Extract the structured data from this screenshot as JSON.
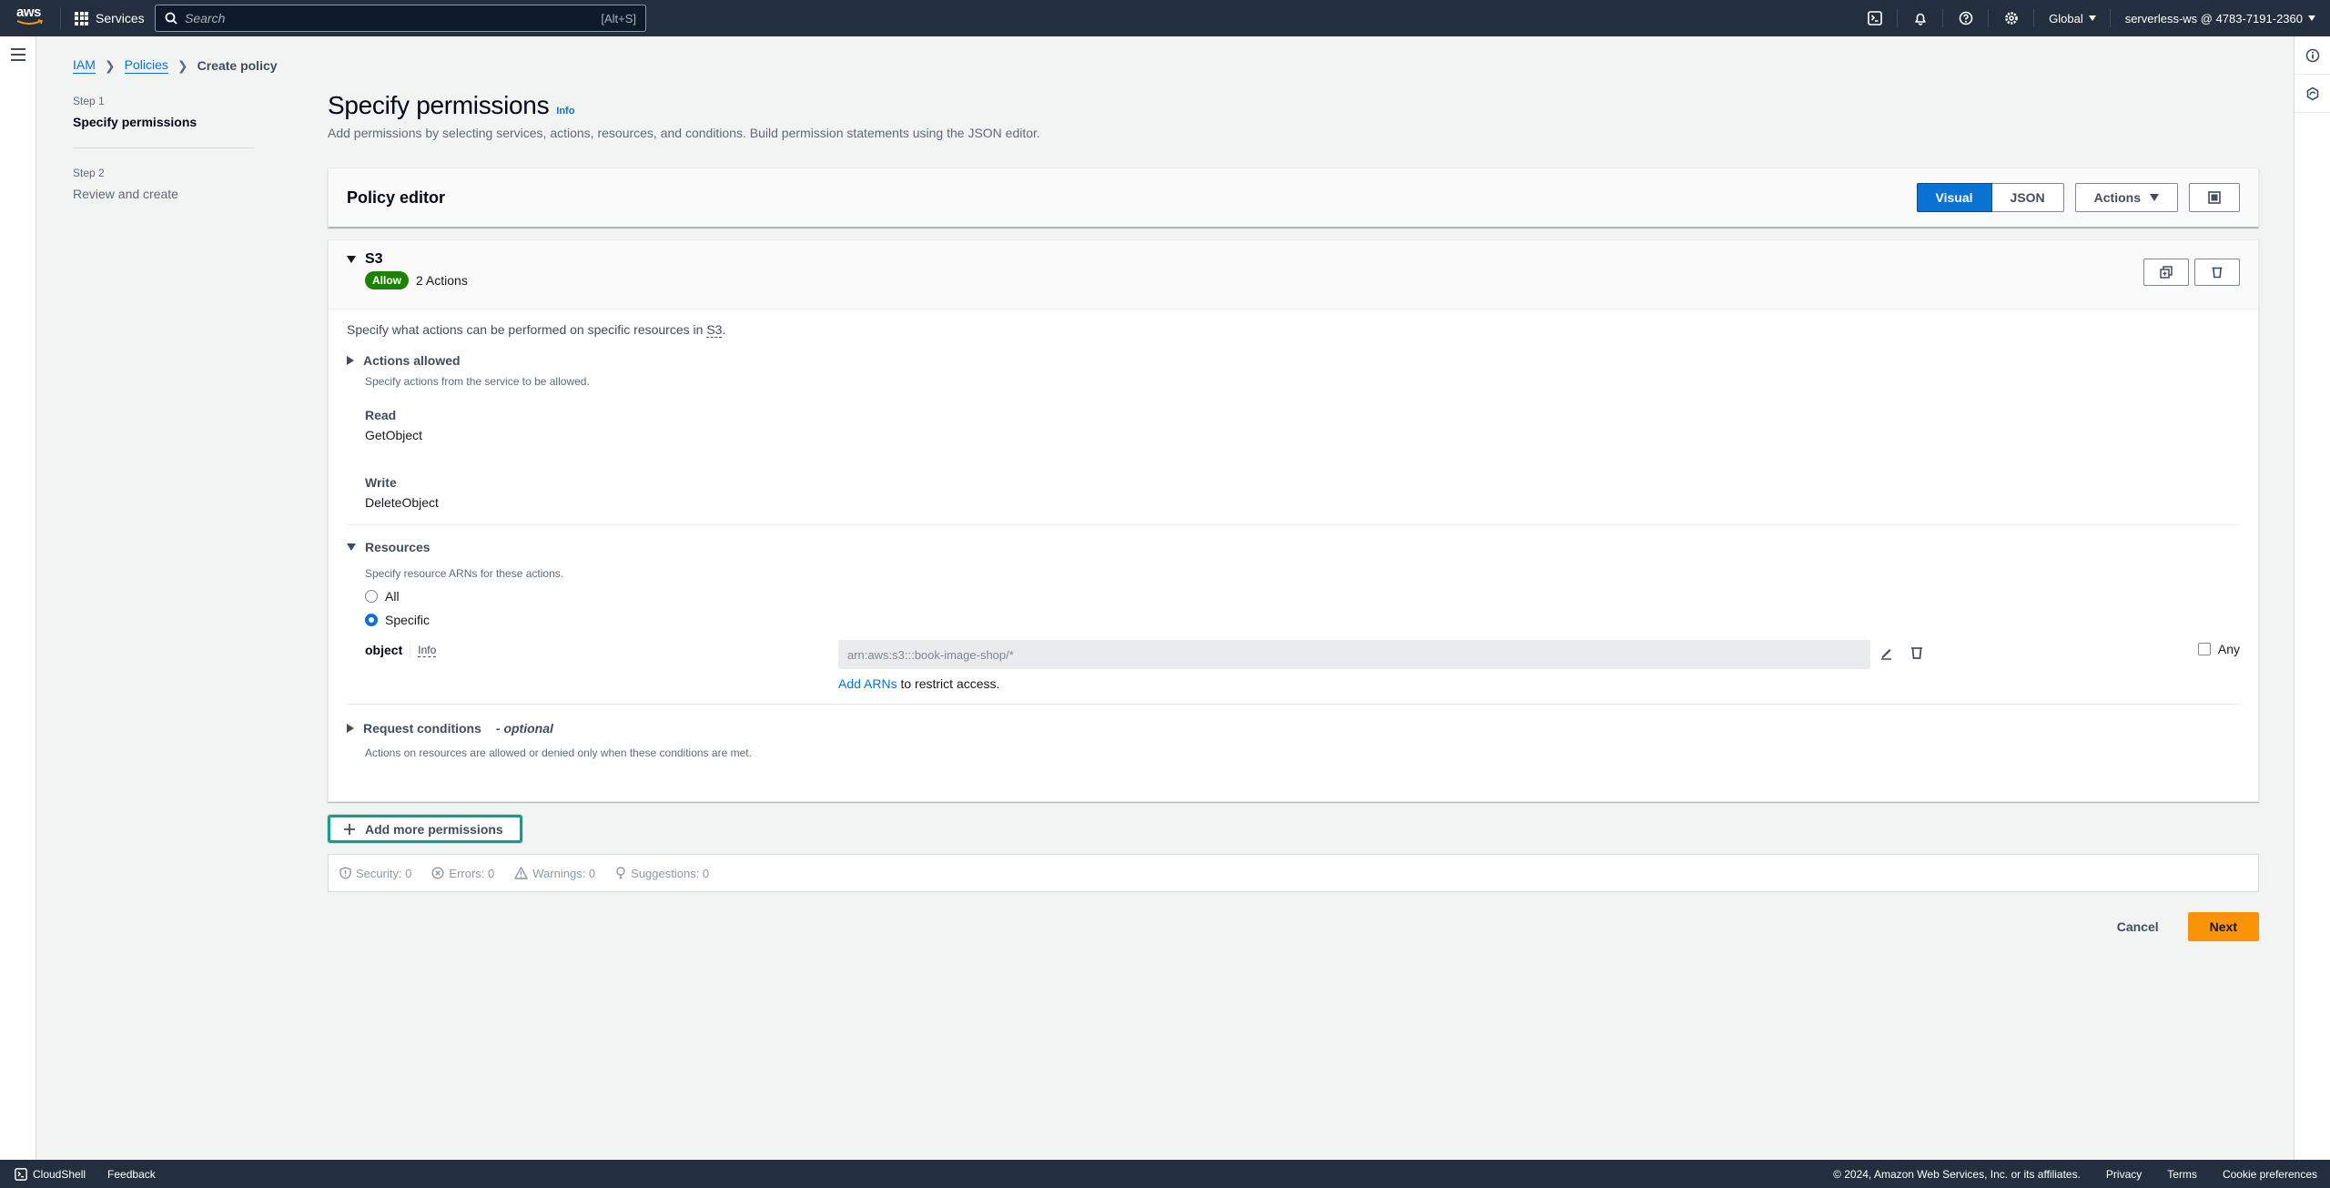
{
  "topnav": {
    "logo_text": "aws",
    "services_label": "Services",
    "search_placeholder": "Search",
    "search_shortcut": "[Alt+S]",
    "region_label": "Global",
    "account_label": "serverless-ws @ 4783-7191-2360",
    "icons": [
      "cloudshell-icon",
      "bell-icon",
      "help-icon",
      "gear-icon"
    ]
  },
  "breadcrumb": {
    "items": [
      {
        "label": "IAM",
        "link": true
      },
      {
        "label": "Policies",
        "link": true
      },
      {
        "label": "Create policy",
        "link": false
      }
    ]
  },
  "steps": [
    {
      "step": "Step 1",
      "title": "Specify permissions",
      "active": true
    },
    {
      "step": "Step 2",
      "title": "Review and create",
      "active": false
    }
  ],
  "page": {
    "title": "Specify permissions",
    "info_label": "Info",
    "description": "Add permissions by selecting services, actions, resources, and conditions. Build permission statements using the JSON editor."
  },
  "policy_editor": {
    "title": "Policy editor",
    "modes": [
      "Visual",
      "JSON"
    ],
    "selected_mode": "Visual",
    "actions_label": "Actions"
  },
  "statement": {
    "service": "S3",
    "effect_badge": "Allow",
    "actions_count": "2 Actions",
    "description_prefix": "Specify what actions can be performed on specific resources in ",
    "description_service": "S3",
    "description_suffix": ".",
    "actions_allowed": {
      "title": "Actions allowed",
      "description": "Specify actions from the service to be allowed.",
      "groups": [
        {
          "label": "Read",
          "items": [
            "GetObject"
          ]
        },
        {
          "label": "Write",
          "items": [
            "DeleteObject"
          ]
        }
      ]
    },
    "resources": {
      "title": "Resources",
      "description": "Specify resource ARNs for these actions.",
      "options": [
        "All",
        "Specific"
      ],
      "selected": "Specific",
      "resource_type": "object",
      "info_label": "Info",
      "arn_value": "arn:aws:s3:::book-image-shop/*",
      "add_arns_link": "Add ARNs",
      "add_arns_suffix": " to restrict access.",
      "any_label": "Any",
      "any_checked": false
    },
    "request_conditions": {
      "title": "Request conditions",
      "optional_label": "- optional",
      "description": "Actions on resources are allowed or denied only when these conditions are met."
    }
  },
  "add_more_label": "Add more permissions",
  "validation": {
    "security": "Security: 0",
    "errors": "Errors: 0",
    "warnings": "Warnings: 0",
    "suggestions": "Suggestions: 0"
  },
  "footer_actions": {
    "cancel_label": "Cancel",
    "next_label": "Next"
  },
  "bottombar": {
    "cloudshell_label": "CloudShell",
    "feedback_label": "Feedback",
    "copyright": "© 2024, Amazon Web Services, Inc. or its affiliates.",
    "links": [
      "Privacy",
      "Terms",
      "Cookie preferences"
    ]
  },
  "colors": {
    "nav_bg": "#232f3e",
    "primary_blue": "#0972d3",
    "allow_green": "#1d8102",
    "next_orange": "#f89406",
    "focus_teal": "#0fa08a"
  }
}
